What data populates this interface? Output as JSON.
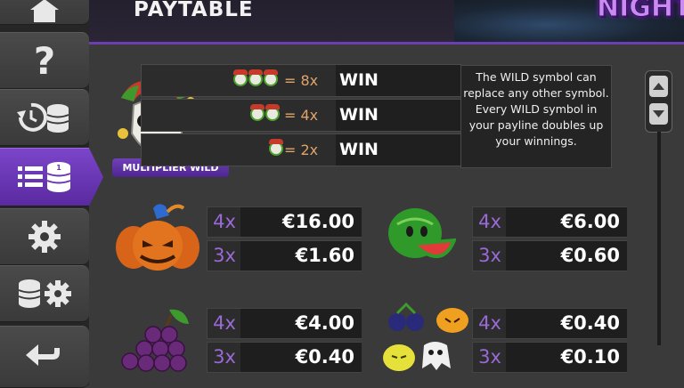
{
  "header": {
    "title": "PAYTABLE",
    "logo_text": "NIGHT"
  },
  "sidebar": {
    "items": [
      {
        "name": "home-button",
        "icon": "home-icon"
      },
      {
        "name": "help-button",
        "icon": "question-icon",
        "glyph": "?"
      },
      {
        "name": "history-button",
        "icon": "history-coins-icon"
      },
      {
        "name": "paytable-button",
        "icon": "paytable-list-icon",
        "active": true
      },
      {
        "name": "settings-button",
        "icon": "gear-icon"
      },
      {
        "name": "bet-settings-button",
        "icon": "coins-gear-icon"
      },
      {
        "name": "back-button",
        "icon": "back-arrow-icon"
      }
    ]
  },
  "wild": {
    "label": "MULTIPLIER WILD",
    "rows": [
      {
        "count": 3,
        "mult": "= 8x",
        "win": "WIN"
      },
      {
        "count": 2,
        "mult": "= 4x",
        "win": "WIN"
      },
      {
        "count": 1,
        "mult": "= 2x",
        "win": "WIN"
      }
    ],
    "description": "The WILD symbol can replace any other symbol. Every WILD symbol in your payline doubles up your winnings."
  },
  "pay": [
    {
      "symbol": "pumpkin",
      "rows": [
        {
          "mult": "4x",
          "amount": "€16.00"
        },
        {
          "mult": "3x",
          "amount": "€1.60"
        }
      ]
    },
    {
      "symbol": "watermelon",
      "rows": [
        {
          "mult": "4x",
          "amount": "€6.00"
        },
        {
          "mult": "3x",
          "amount": "€0.60"
        }
      ]
    },
    {
      "symbol": "grapes",
      "rows": [
        {
          "mult": "4x",
          "amount": "€4.00"
        },
        {
          "mult": "3x",
          "amount": "€0.40"
        }
      ]
    },
    {
      "symbol": "mixed-fruits",
      "rows": [
        {
          "mult": "4x",
          "amount": "€0.40"
        },
        {
          "mult": "3x",
          "amount": "€0.10"
        }
      ]
    }
  ],
  "colors": {
    "accent": "#7b45c9",
    "multiplier": "#9a6ad6",
    "wild_multiplier": "#e0a46a"
  }
}
